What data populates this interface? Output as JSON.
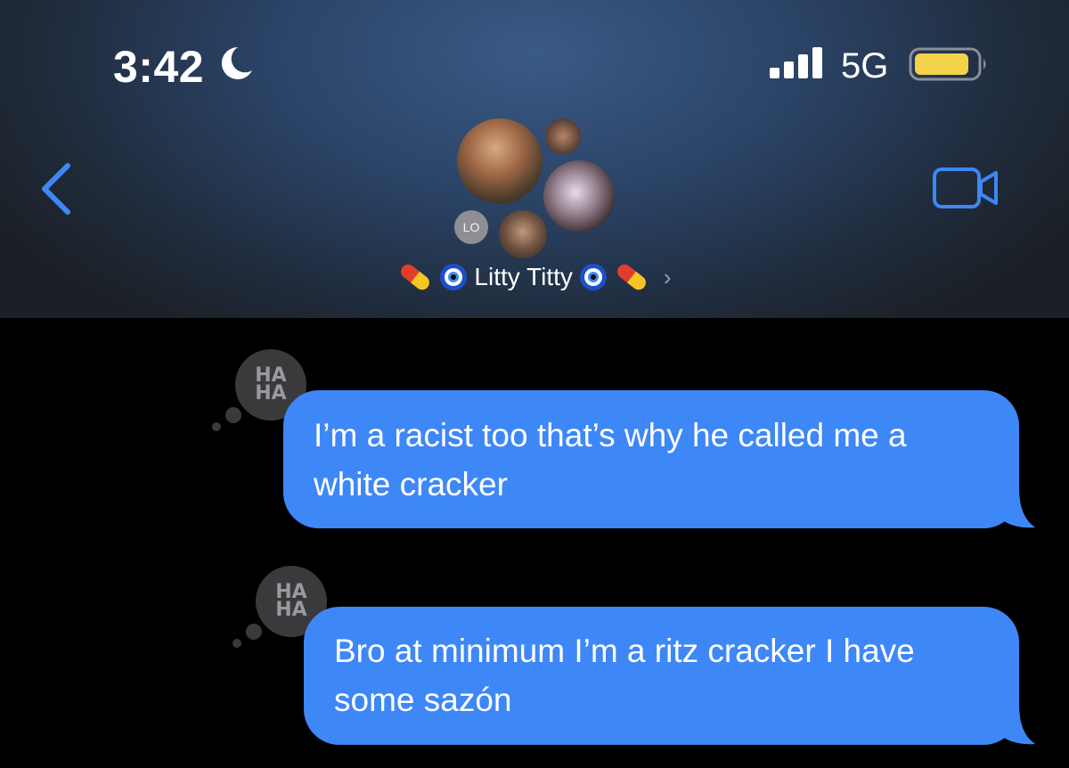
{
  "status_bar": {
    "time": "3:42",
    "network": "5G",
    "battery_color": "#f3d24c"
  },
  "header": {
    "avatar_initials": "LO",
    "group_name": "Litty Titty",
    "emojis_left": [
      "pill",
      "evil-eye"
    ],
    "emojis_right": [
      "evil-eye",
      "pill"
    ],
    "accent_color": "#3e87f7"
  },
  "messages": [
    {
      "text": "I’m a racist too that’s why he called me a white cracker",
      "reaction": "HA HA",
      "sender": "me"
    },
    {
      "text": "Bro at minimum I’m a ritz cracker I have some sazón",
      "reaction": "HA HA",
      "sender": "me"
    }
  ]
}
